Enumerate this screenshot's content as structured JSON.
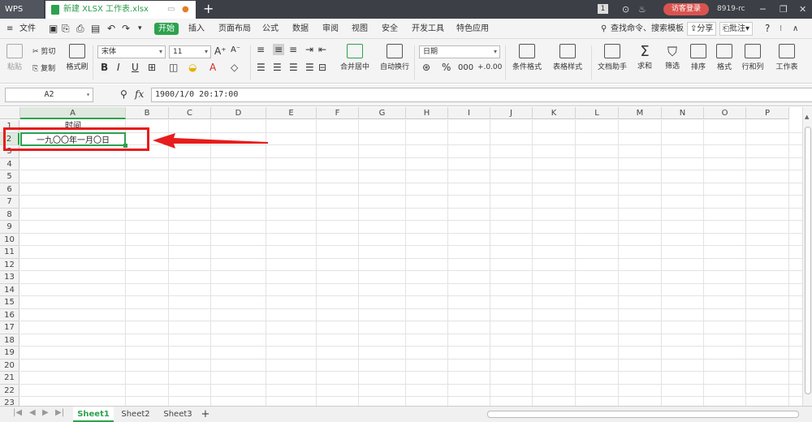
{
  "titlebar": {
    "app_name": "WPS",
    "doc_tab": "新建 XLSX 工作表.xlsx",
    "login": "访客登录",
    "user": "8919-rc",
    "badge": "1"
  },
  "menu": {
    "file": "文件",
    "start": "开始",
    "items": [
      "插入",
      "页面布局",
      "公式",
      "数据",
      "审阅",
      "视图",
      "安全",
      "开发工具",
      "特色应用"
    ],
    "search": "查找命令、搜索模板",
    "share": "分享",
    "comment": "批注"
  },
  "ribbon": {
    "paste": "粘贴",
    "cut": "剪切",
    "copy": "复制",
    "format_painter": "格式刷",
    "font_name": "宋体",
    "font_size": "11",
    "merge": "合并居中",
    "wrap": "自动换行",
    "number_format": "日期",
    "cond_format": "条件格式",
    "table_style": "表格样式",
    "doc_helper": "文档助手",
    "sum": "求和",
    "filter": "筛选",
    "sort": "排序",
    "format": "格式",
    "rows_cols": "行和列",
    "worksheet": "工作表"
  },
  "formula_bar": {
    "name_box": "A2",
    "fx": "fx",
    "formula": "1900/1/0 20:17:00"
  },
  "columns": [
    "A",
    "B",
    "C",
    "D",
    "E",
    "F",
    "G",
    "H",
    "I",
    "J",
    "K",
    "L",
    "M",
    "N",
    "O",
    "P"
  ],
  "rows": [
    "1",
    "2",
    "3",
    "4",
    "5",
    "6",
    "7",
    "8",
    "9",
    "10",
    "11",
    "12",
    "13",
    "14",
    "15",
    "16",
    "17",
    "18",
    "19",
    "20",
    "21",
    "22",
    "23"
  ],
  "cells": {
    "A1": "时间",
    "A2": "一九〇〇年一月〇日"
  },
  "sheets": [
    "Sheet1",
    "Sheet2",
    "Sheet3"
  ],
  "active_sheet": "Sheet1",
  "colors": {
    "accent": "#2ca24e",
    "annotation": "#e81c1c"
  }
}
